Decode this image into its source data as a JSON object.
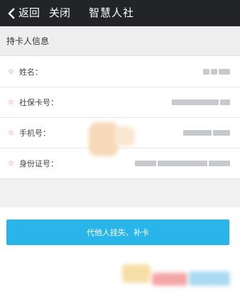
{
  "header": {
    "back_label": "返回",
    "close_label": "关闭",
    "title": "智慧人社"
  },
  "section": {
    "title": "持卡人信息"
  },
  "rows": [
    {
      "label": "姓名："
    },
    {
      "label": "社保卡号："
    },
    {
      "label": "手机号："
    },
    {
      "label": "身份证号："
    }
  ],
  "action": {
    "label": "代他人挂失、补卡"
  },
  "colors": {
    "header_bg": "#222428",
    "accent": "#2ab5ea",
    "required_star": "#e05a5a"
  }
}
